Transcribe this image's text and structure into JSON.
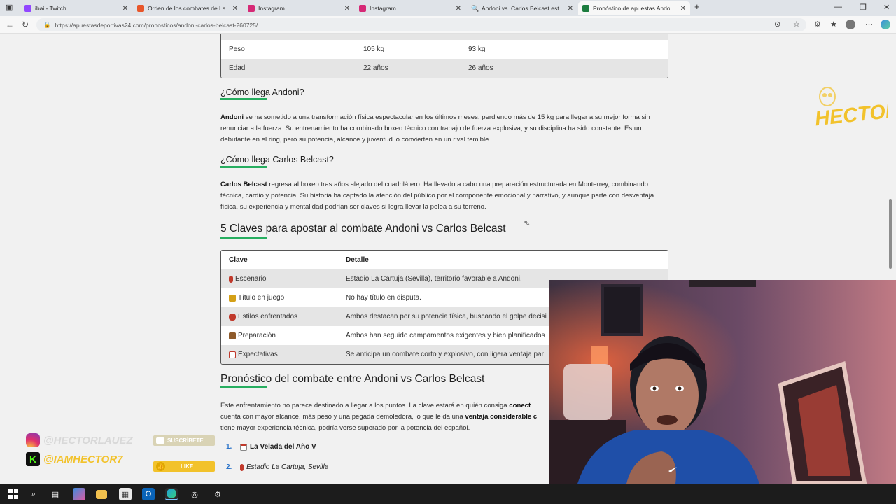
{
  "tabs": [
    {
      "label": "ibai - Twitch",
      "color": "#9146ff"
    },
    {
      "label": "Orden de los combates de La Vel",
      "color": "#e8562a"
    },
    {
      "label": "Instagram",
      "color": "#d62976"
    },
    {
      "label": "Instagram",
      "color": "#d62976"
    },
    {
      "label": "Andoni vs. Carlos Belcast estadís",
      "color": "#3b6ce6"
    },
    {
      "label": "Pronóstico de apuestas Andoni vs",
      "color": "#1c7c3f"
    }
  ],
  "url": "https://apuestasdeportivas24.com/pronosticos/andoni-carlos-belcast-260725/",
  "stats_rows": [
    {
      "label": "Peso",
      "a": "105 kg",
      "b": "93 kg"
    },
    {
      "label": "Edad",
      "a": "22 años",
      "b": "26 años"
    }
  ],
  "section_andoni": {
    "title": "¿Cómo llega Andoni?",
    "bold": "Andoni",
    "text": " se ha sometido a una transformación física espectacular en los últimos meses, perdiendo más de 15 kg para llegar a su mejor forma sin renunciar a la fuerza. Su entrenamiento ha combinado boxeo técnico con trabajo de fuerza explosiva, y su disciplina ha sido constante. Es un debutante en el ring, pero su potencia, alcance y juventud lo convierten en un rival temible."
  },
  "section_carlos": {
    "title": "¿Cómo llega Carlos Belcast?",
    "bold": "Carlos Belcast",
    "text": " regresa al boxeo tras años alejado del cuadrilátero. Ha llevado a cabo una preparación estructurada en Monterrey, combinando técnica, cardio y potencia. Su historia ha captado la atención del público por el componente emocional y narrativo, y aunque parte con desventaja física, su experiencia y mentalidad podrían ser claves si logra llevar la pelea a su terreno."
  },
  "keys_title": "5 Claves para apostar al combate Andoni vs Carlos Belcast",
  "keys_header": {
    "col1": "Clave",
    "col2": "Detalle"
  },
  "keys_rows": [
    {
      "icon": "pin-icon",
      "icon_color": "#c0392b",
      "clave": "Escenario",
      "detalle": "Estadio La Cartuja (Sevilla), territorio favorable a Andoni."
    },
    {
      "icon": "trophy-icon",
      "icon_color": "#d4a017",
      "clave": "Título en juego",
      "detalle": "No hay título en disputa."
    },
    {
      "icon": "boxing-glove-icon",
      "icon_color": "#c0392b",
      "clave": "Estilos enfrentados",
      "detalle": "Ambos destacan por su potencia física, buscando el golpe decisi"
    },
    {
      "icon": "weight-icon",
      "icon_color": "#8e5a2a",
      "clave": "Preparación",
      "detalle": "Ambos han seguido campamentos exigentes y bien planificados"
    },
    {
      "icon": "chart-icon",
      "icon_color": "#c0392b",
      "clave": "Expectativas",
      "detalle": "Se anticipa un combate corto y explosivo, con ligera ventaja par"
    }
  ],
  "prono_title": "Pronóstico del combate entre Andoni vs Carlos Belcast",
  "prono_para": {
    "text1": "Este enfrentamiento no parece destinado a llegar a los puntos. La clave estará en quién consiga ",
    "bold1": "conect",
    "line2a": "cuenta con mayor alcance, más peso y una pegada demoledora, lo que le da una ",
    "bold2": "ventaja considerable c",
    "line3": "tiene mayor experiencia técnica, podría verse superado por la potencia del español."
  },
  "list": [
    {
      "n": "1.",
      "icon": "calendar-icon",
      "text": "La Velada del Año V"
    },
    {
      "n": "2.",
      "icon": "pin-icon",
      "text": "Estadio La Cartuja, Sevilla"
    }
  ],
  "overlay": {
    "instagram_handle": "@HECTORLAUEZ",
    "kick_handle": "@IAMHECTOR7",
    "subscribe": "SUSCRÍBETE",
    "like": "LIKE",
    "logo_text": "HECTOR"
  }
}
